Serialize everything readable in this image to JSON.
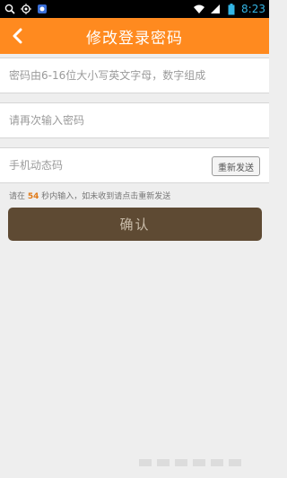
{
  "status_bar": {
    "time": "8:23",
    "left_icons": [
      "search-icon",
      "location-icon",
      "app-icon"
    ],
    "right_icons": [
      "wifi-icon",
      "signal-icon",
      "battery-icon"
    ]
  },
  "header": {
    "title": "修改登录密码",
    "back_icon": "chevron-left-icon"
  },
  "form": {
    "password_placeholder": "密码由6-16位大小写英文字母，数字组成",
    "confirm_placeholder": "请再次输入密码",
    "code_placeholder": "手机动态码",
    "resend_label": "重新发送"
  },
  "hint": {
    "prefix": "请在",
    "seconds": "54",
    "suffix": "秒内输入，如未收到请点击重新发送"
  },
  "confirm_label": "确认",
  "colors": {
    "header": "#ff8a1f",
    "button": "#5e4a33",
    "countdown": "#e07b1a"
  }
}
